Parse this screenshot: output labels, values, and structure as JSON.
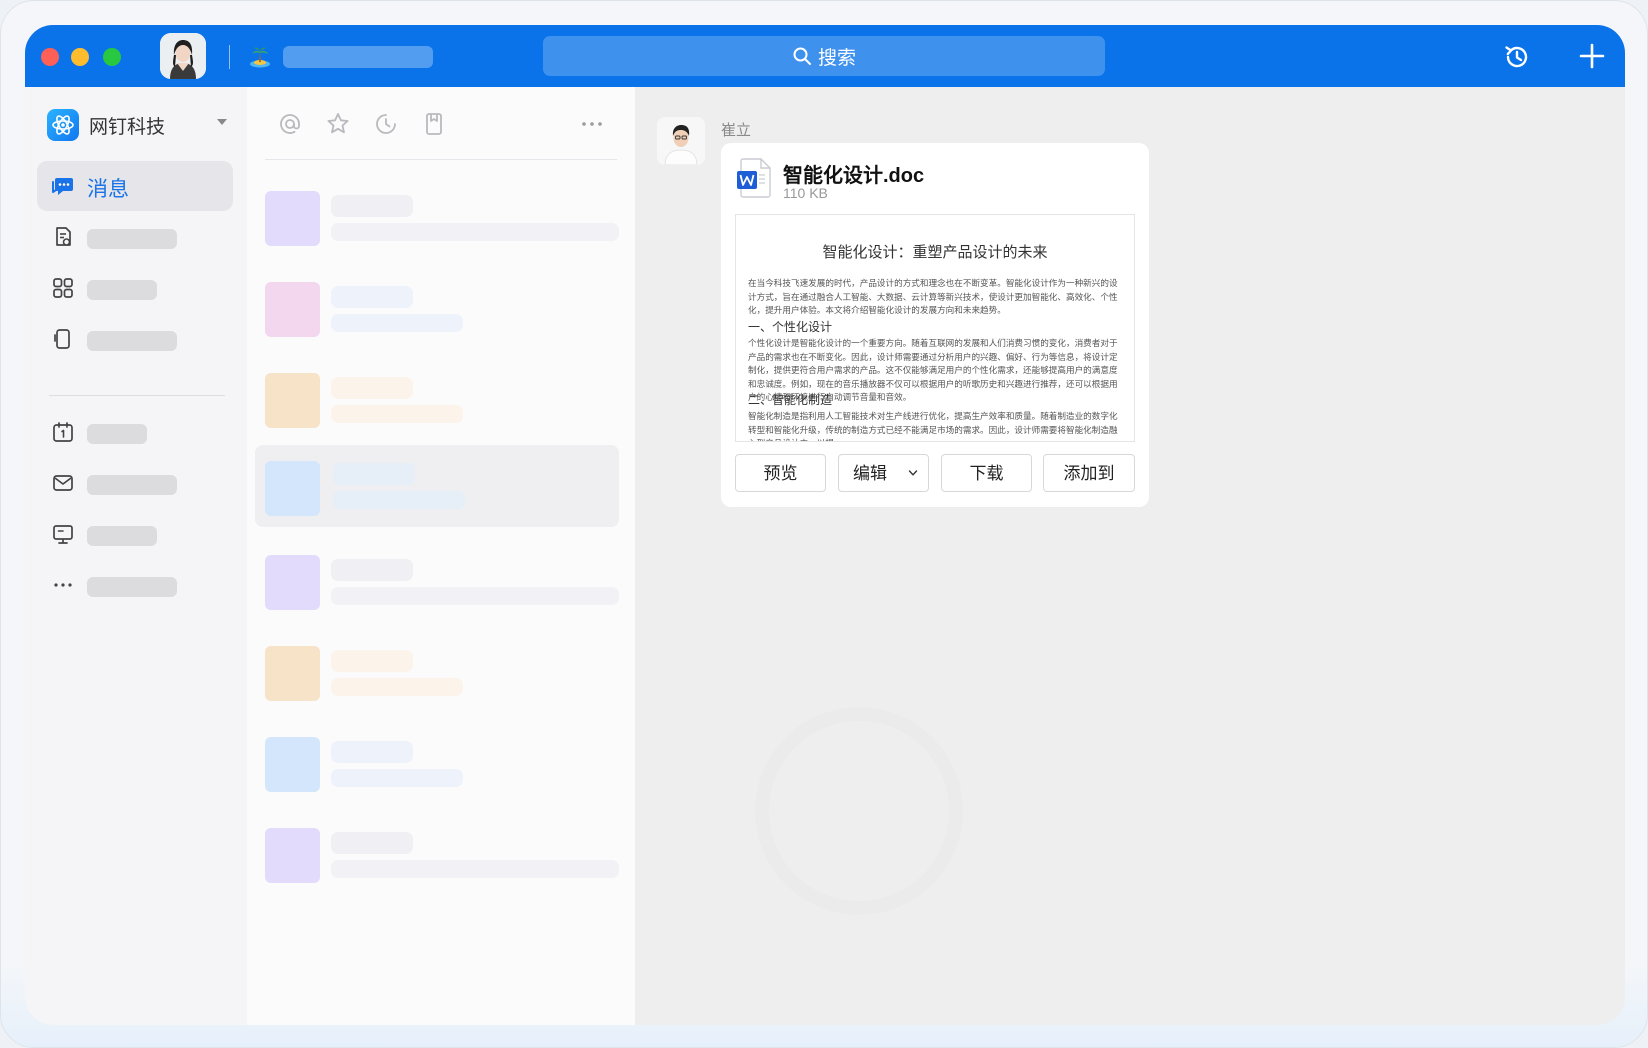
{
  "search": {
    "label": "搜索"
  },
  "sidebar": {
    "org_name": "网钉科技",
    "active_item": {
      "label": "消息"
    },
    "items": [
      {
        "icon": "document-clip-icon"
      },
      {
        "icon": "apps-grid-icon"
      },
      {
        "icon": "phone-device-icon"
      },
      {
        "icon": "calendar-icon"
      },
      {
        "icon": "mail-icon"
      },
      {
        "icon": "monitor-icon"
      },
      {
        "icon": "more-icon"
      }
    ]
  },
  "list_toolbar": {
    "icons": [
      "at-mention-icon",
      "star-icon",
      "recent-clock-icon",
      "bookmark-icon",
      "more-horizontal-icon"
    ]
  },
  "chat": {
    "sender_name": "崔立",
    "file": {
      "name": "智能化设计.doc",
      "size": "110 KB"
    },
    "preview": {
      "title": "智能化设计：重塑产品设计的未来",
      "intro": "在当今科技飞速发展的时代，产品设计的方式和理念也在不断变革。智能化设计作为一种新兴的设计方式，旨在通过融合人工智能、大数据、云计算等新兴技术，使设计更加智能化、高效化、个性化，提升用户体验。本文将介绍智能化设计的发展方向和未来趋势。",
      "h1": "一、个性化设计",
      "p1": "个性化设计是智能化设计的一个重要方向。随着互联网的发展和人们消费习惯的变化，消费者对于产品的需求也在不断变化。因此，设计师需要通过分析用户的兴趣、偏好、行为等信息，将设计定制化，提供更符合用户需求的产品。这不仅能够满足用户的个性化需求，还能够提高用户的满意度和忠诚度。例如，现在的音乐播放器不仅可以根据用户的听歌历史和兴趣进行推荐，还可以根据用户的心情和环境进行自动调节音量和音效。",
      "h2": "二、智能化制造",
      "p2": "智能化制造是指利用人工智能技术对生产线进行优化，提高生产效率和质量。随着制造业的数字化转型和智能化升级，传统的制造方式已经不能满足市场的需求。因此，设计师需要将智能化制造融入到产品设计中，以提"
    },
    "actions": {
      "preview": "预览",
      "edit": "编辑",
      "download": "下载",
      "add_to": "添加到"
    }
  },
  "colors": {
    "titlebar": "#0a73ea",
    "accent": "#1a73e8"
  }
}
